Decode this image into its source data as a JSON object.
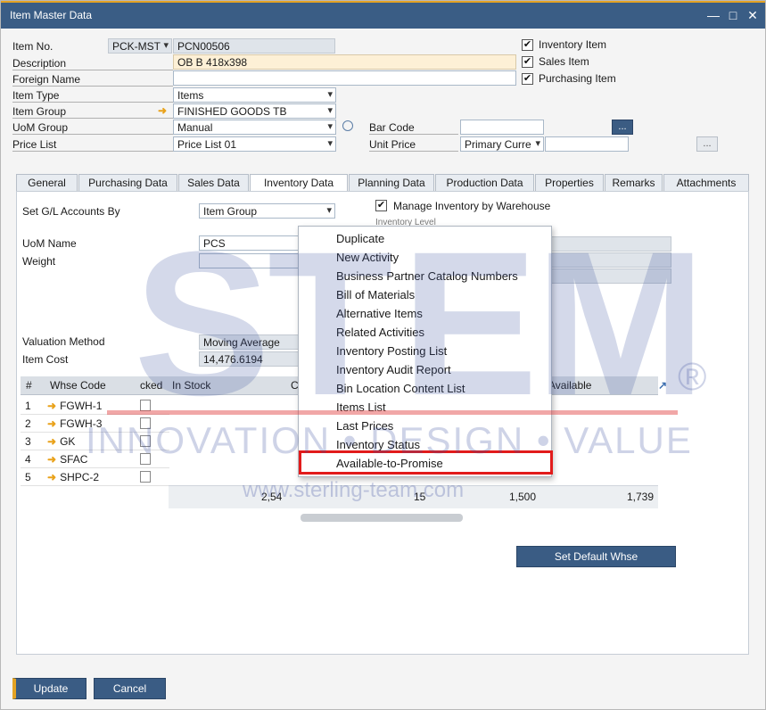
{
  "window": {
    "title": "Item Master Data",
    "controls": {
      "minimize": "—",
      "maximize": "□",
      "close": "✕"
    }
  },
  "header": {
    "item_no_label": "Item No.",
    "item_no_series": "PCK-MST",
    "item_no_value": "PCN00506",
    "description_label": "Description",
    "description_value": "OB B 418x398",
    "foreign_name_label": "Foreign Name",
    "foreign_name_value": "",
    "item_type_label": "Item Type",
    "item_type_value": "Items",
    "item_group_label": "Item Group",
    "item_group_value": "FINISHED GOODS TB",
    "uom_group_label": "UoM Group",
    "uom_group_value": "Manual",
    "price_list_label": "Price List",
    "price_list_value": "Price List 01",
    "bar_code_label": "Bar Code",
    "bar_code_value": "",
    "unit_price_label": "Unit Price",
    "unit_price_currency": "Primary Curre",
    "unit_price_value": "",
    "browse_btn": "...",
    "inventory_item_label": "Inventory Item",
    "sales_item_label": "Sales Item",
    "purchasing_item_label": "Purchasing Item",
    "checkmark": "✔"
  },
  "tabs": [
    "General",
    "Purchasing Data",
    "Sales Data",
    "Inventory Data",
    "Planning Data",
    "Production Data",
    "Properties",
    "Remarks",
    "Attachments"
  ],
  "inventory": {
    "gl_label": "Set G/L Accounts By",
    "gl_value": "Item Group",
    "manage_by_wh_label": "Manage Inventory by Warehouse",
    "inventory_level_label": "Inventory Level",
    "uom_name_label": "UoM Name",
    "uom_name_value": "PCS",
    "weight_label": "Weight",
    "weight_value": "",
    "valuation_label": "Valuation Method",
    "valuation_value": "Moving Average",
    "item_cost_label": "Item Cost",
    "item_cost_value": "14,476.6194",
    "grid_headers": {
      "num": "#",
      "whse": "Whse Code",
      "locked": "cked",
      "in_stock": "In Stock",
      "committed": "C",
      "available": "Available"
    },
    "grid_rows": [
      {
        "n": "1",
        "code": "FGWH-1"
      },
      {
        "n": "2",
        "code": "FGWH-3"
      },
      {
        "n": "3",
        "code": "GK"
      },
      {
        "n": "4",
        "code": "SFAC"
      },
      {
        "n": "5",
        "code": "SHPC-2"
      }
    ],
    "totals": {
      "in_stock": "2,54",
      "committed": "15",
      "ordered": "1,500",
      "available": "1,739"
    },
    "set_default_whse": "Set Default Whse",
    "expand_icon": "↗"
  },
  "context_menu": {
    "items": [
      "Duplicate",
      "New Activity",
      "Business Partner Catalog Numbers",
      "Bill of Materials",
      "Alternative Items",
      "Related Activities",
      "Inventory Posting List",
      "Inventory Audit Report",
      "Bin Location Content List",
      "Items List",
      "Last Prices",
      "Inventory Status",
      "Available-to-Promise"
    ],
    "highlighted": "Available-to-Promise",
    "highlight_color": "#e21b1b"
  },
  "footer": {
    "update_label": "Update",
    "cancel_label": "Cancel"
  },
  "watermark": {
    "letters": [
      "S",
      "T",
      "E",
      "M"
    ],
    "tagline": "INNOVATION • DESIGN • VALUE",
    "url": "www.sterling-team.com",
    "registered": "®"
  },
  "colors": {
    "titlebar": "#3a5d85",
    "accent": "#e3a324",
    "button": "#3a5c84"
  }
}
